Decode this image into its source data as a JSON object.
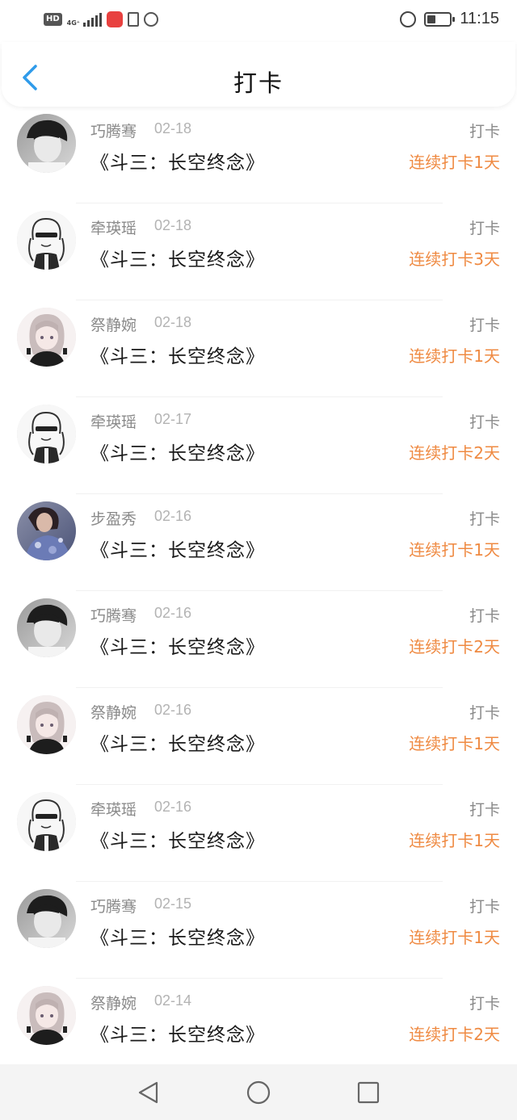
{
  "status_bar": {
    "hd_label": "HD",
    "network": "4G⁺",
    "time": "11:15",
    "icons": [
      "hd-icon",
      "signal-icon",
      "app-notification-icon",
      "document-icon",
      "shield-icon",
      "alarm-icon",
      "battery-icon"
    ]
  },
  "header": {
    "title": "打卡",
    "back_icon": "chevron-left-icon",
    "accent_color": "#2f9bea"
  },
  "colors": {
    "streak": "#ef8a42",
    "name": "#8a8a8a",
    "date": "#b3b3b3"
  },
  "checkins": [
    {
      "name": "巧腾骞",
      "date": "02-18",
      "book": "《斗三：长空终念》",
      "action": "打卡",
      "streak": "连续打卡1天",
      "avatar": "photo-boy"
    },
    {
      "name": "牵瑛瑶",
      "date": "02-18",
      "book": "《斗三：长空终念》",
      "action": "打卡",
      "streak": "连续打卡3天",
      "avatar": "sketch-girl"
    },
    {
      "name": "祭静婉",
      "date": "02-18",
      "book": "《斗三：长空终念》",
      "action": "打卡",
      "streak": "连续打卡1天",
      "avatar": "anime-girl"
    },
    {
      "name": "牵瑛瑶",
      "date": "02-17",
      "book": "《斗三：长空终念》",
      "action": "打卡",
      "streak": "连续打卡2天",
      "avatar": "sketch-girl"
    },
    {
      "name": "步盈秀",
      "date": "02-16",
      "book": "《斗三：长空终念》",
      "action": "打卡",
      "streak": "连续打卡1天",
      "avatar": "photo-woman"
    },
    {
      "name": "巧腾骞",
      "date": "02-16",
      "book": "《斗三：长空终念》",
      "action": "打卡",
      "streak": "连续打卡2天",
      "avatar": "photo-boy"
    },
    {
      "name": "祭静婉",
      "date": "02-16",
      "book": "《斗三：长空终念》",
      "action": "打卡",
      "streak": "连续打卡1天",
      "avatar": "anime-girl"
    },
    {
      "name": "牵瑛瑶",
      "date": "02-16",
      "book": "《斗三：长空终念》",
      "action": "打卡",
      "streak": "连续打卡1天",
      "avatar": "sketch-girl"
    },
    {
      "name": "巧腾骞",
      "date": "02-15",
      "book": "《斗三：长空终念》",
      "action": "打卡",
      "streak": "连续打卡1天",
      "avatar": "photo-boy"
    },
    {
      "name": "祭静婉",
      "date": "02-14",
      "book": "《斗三：长空终念》",
      "action": "打卡",
      "streak": "连续打卡2天",
      "avatar": "anime-girl"
    }
  ],
  "nav_bar": {
    "buttons": [
      "back-triangle-icon",
      "home-circle-icon",
      "recents-square-icon"
    ]
  }
}
